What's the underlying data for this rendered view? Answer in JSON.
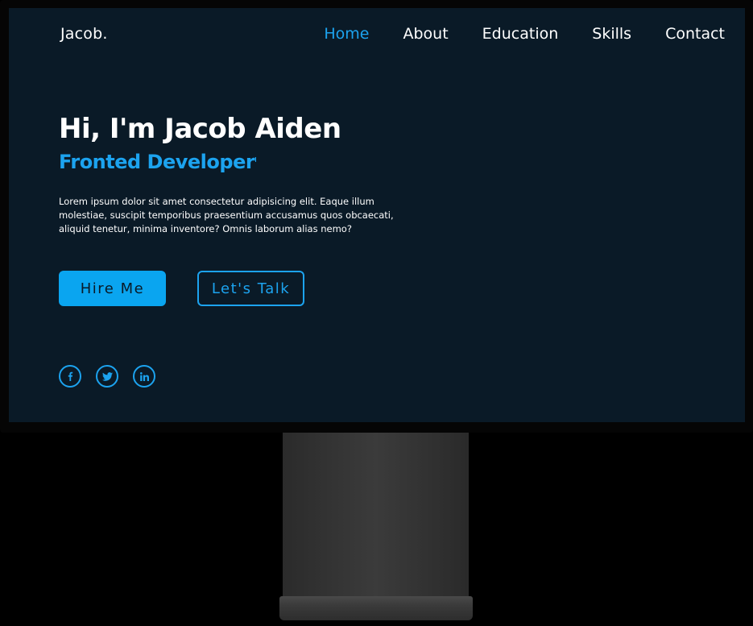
{
  "logo": "Jacob.",
  "nav": {
    "items": [
      {
        "label": "Home",
        "active": true
      },
      {
        "label": "About",
        "active": false
      },
      {
        "label": "Education",
        "active": false
      },
      {
        "label": "Skills",
        "active": false
      },
      {
        "label": "Contact",
        "active": false
      }
    ]
  },
  "hero": {
    "title": "Hi, I'm Jacob Aiden",
    "subtitle": "Fronted Developer",
    "description": "Lorem ipsum dolor sit amet consectetur adipisicing elit. Eaque illum molestiae, suscipit temporibus praesentium accusamus quos obcaecati, aliquid tenetur, minima inventore? Omnis laborum alias nemo?",
    "primary_button": "Hire Me",
    "secondary_button": "Let's Talk"
  },
  "socials": [
    {
      "icon": "facebook-icon",
      "glyph": "f"
    },
    {
      "icon": "twitter-icon",
      "glyph": "t"
    },
    {
      "icon": "linkedin-icon",
      "glyph": "in"
    }
  ],
  "colors": {
    "accent": "#1ca3ef",
    "background": "#0a1a27",
    "text": "#ffffff"
  }
}
